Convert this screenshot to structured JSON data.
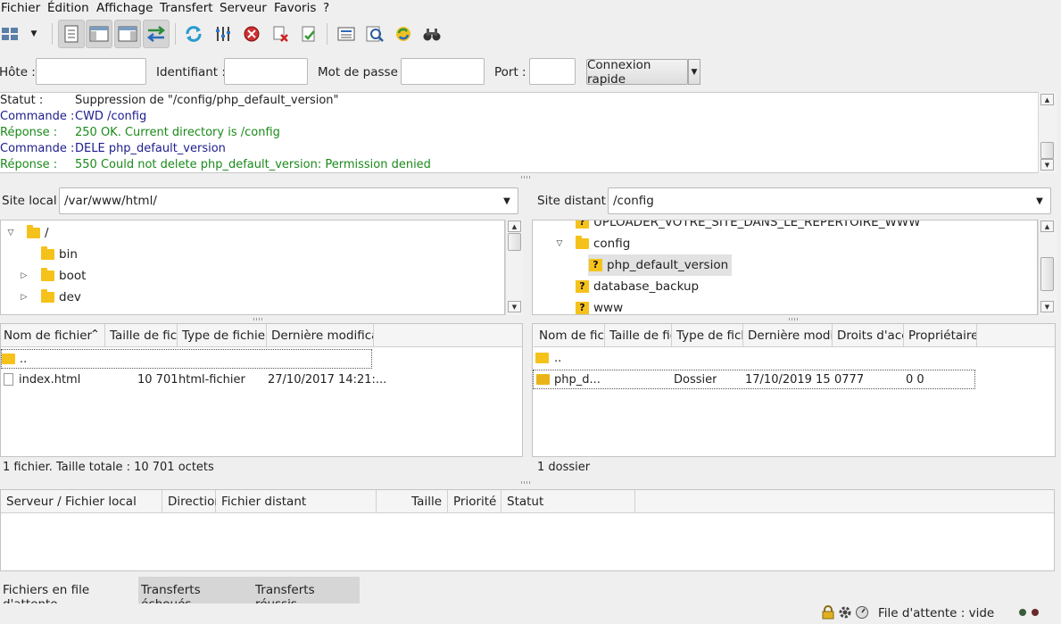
{
  "menu": [
    "Fichier",
    "Édition",
    "Affichage",
    "Transfert",
    "Serveur",
    "Favoris",
    "?"
  ],
  "toolbar": {
    "icons": [
      "site-manager-icon",
      "dropdown-arrow-icon",
      "toggle-log-icon",
      "toggle-local-tree-icon",
      "toggle-remote-tree-icon",
      "toggle-queue-icon",
      "refresh-icon",
      "filter-icon",
      "cancel-icon",
      "disconnect-icon",
      "reconnect-icon",
      "directory-listing-icon",
      "compare-icon",
      "sync-browse-icon",
      "find-icon"
    ]
  },
  "quickconnect": {
    "host_label": "Hôte :",
    "user_label": "Identifiant :",
    "pass_label": "Mot de passe :",
    "port_label": "Port :",
    "host_value": "",
    "user_value": "",
    "pass_value": "",
    "port_value": "",
    "button": "Connexion rapide"
  },
  "log": [
    {
      "key": "Statut :",
      "value": "Suppression de \"/config/php_default_version\"",
      "color": "#222222"
    },
    {
      "key": "Commande :",
      "value": "CWD /config",
      "color": "#1c1c8c"
    },
    {
      "key": "Réponse :",
      "value": "250 OK. Current directory is /config",
      "color": "#1a8a1a"
    },
    {
      "key": "Commande :",
      "value": "DELE php_default_version",
      "color": "#1c1c8c"
    },
    {
      "key": "Réponse :",
      "value": "550 Could not delete php_default_version: Permission denied",
      "color": "#1a8a1a"
    }
  ],
  "local": {
    "label": "Site local :",
    "path": "/var/www/html/",
    "tree": [
      {
        "name": "/",
        "expander": "▽"
      },
      {
        "name": "bin",
        "expander": ""
      },
      {
        "name": "boot",
        "expander": "▷"
      },
      {
        "name": "dev",
        "expander": "▷"
      }
    ],
    "columns": [
      "Nom de fichier",
      "Taille de fichi",
      "Type de fichier",
      "Dernière modificati"
    ],
    "sort_indicator": "^",
    "rows": [
      {
        "name": "..",
        "size": "",
        "type": "",
        "modified": ""
      },
      {
        "name": "index.html",
        "size": "10 701",
        "type": "html-fichier",
        "modified": "27/10/2017 14:21:..."
      }
    ],
    "status": "1 fichier. Taille totale : 10 701 octets"
  },
  "remote": {
    "label": "Site distant :",
    "path": "/config",
    "tree": [
      {
        "name": "UPLOADER_VOTRE_SITE_DANS_LE_REPERTOIRE_WWW",
        "unknown": true,
        "expander": ""
      },
      {
        "name": "config",
        "unknown": false,
        "expander": "▽"
      },
      {
        "name": "php_default_version",
        "unknown": true,
        "expander": ""
      },
      {
        "name": "database_backup",
        "unknown": true,
        "expander": ""
      },
      {
        "name": "www",
        "unknown": true,
        "expander": ""
      }
    ],
    "columns": [
      "Nom de fich",
      "Taille de fich",
      "Type de fichi",
      "Dernière modifi",
      "Droits d'accè",
      "Propriétaire/"
    ],
    "rows": [
      {
        "name": "..",
        "size": "",
        "type": "",
        "modified": "",
        "perms": "",
        "owner": ""
      },
      {
        "name": "php_d...",
        "size": "",
        "type": "Dossier",
        "modified": "17/10/2019 15...",
        "perms": "0777",
        "owner": "0 0"
      }
    ],
    "status": "1 dossier"
  },
  "queue": {
    "columns": [
      "Serveur / Fichier local",
      "Direction",
      "Fichier distant",
      "Taille",
      "Priorité",
      "Statut"
    ]
  },
  "tabs": [
    "Fichiers en file d'attente",
    "Transferts échoués",
    "Transferts réussis"
  ],
  "footer": {
    "queue_status": "File d'attente : vide"
  }
}
